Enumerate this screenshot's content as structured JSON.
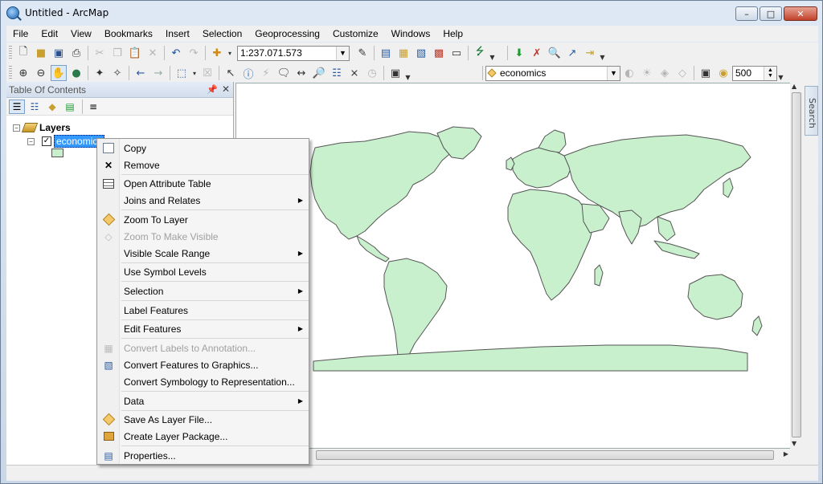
{
  "window": {
    "title": "Untitled - ArcMap"
  },
  "menubar": [
    "File",
    "Edit",
    "View",
    "Bookmarks",
    "Insert",
    "Selection",
    "Geoprocessing",
    "Customize",
    "Windows",
    "Help"
  ],
  "toolbar": {
    "scale": "1:237.071.573",
    "layer_combo": "economics",
    "count_value": "500"
  },
  "toc": {
    "title": "Table Of Contents",
    "root": "Layers",
    "layer": "economics",
    "swatch_color": "#c9f0cc"
  },
  "search_tab": "Search",
  "context_menu": {
    "items": [
      {
        "label": "Copy",
        "icon": "copy-icon"
      },
      {
        "label": "Remove",
        "icon": "remove-icon"
      },
      {
        "label": "Open Attribute Table",
        "icon": "table-icon"
      },
      {
        "label": "Joins and Relates",
        "submenu": true
      },
      {
        "label": "Zoom To Layer",
        "icon": "zoom-layer-icon"
      },
      {
        "label": "Zoom To Make Visible",
        "disabled": true,
        "icon": "zoom-visible-icon"
      },
      {
        "label": "Visible Scale Range",
        "submenu": true
      },
      {
        "label": "Use Symbol Levels"
      },
      {
        "label": "Selection",
        "submenu": true
      },
      {
        "label": "Label Features"
      },
      {
        "label": "Edit Features",
        "submenu": true
      },
      {
        "label": "Convert Labels to Annotation...",
        "disabled": true,
        "icon": "annotation-icon"
      },
      {
        "label": "Convert Features to Graphics...",
        "icon": "graphics-icon"
      },
      {
        "label": "Convert Symbology to Representation..."
      },
      {
        "label": "Data",
        "submenu": true
      },
      {
        "label": "Save As Layer File...",
        "icon": "layer-file-icon"
      },
      {
        "label": "Create Layer Package...",
        "icon": "package-icon"
      },
      {
        "label": "Properties...",
        "icon": "properties-icon"
      }
    ]
  },
  "colors": {
    "land": "#c9f0cc",
    "coast": "#555555",
    "selection": "#3399ff"
  }
}
